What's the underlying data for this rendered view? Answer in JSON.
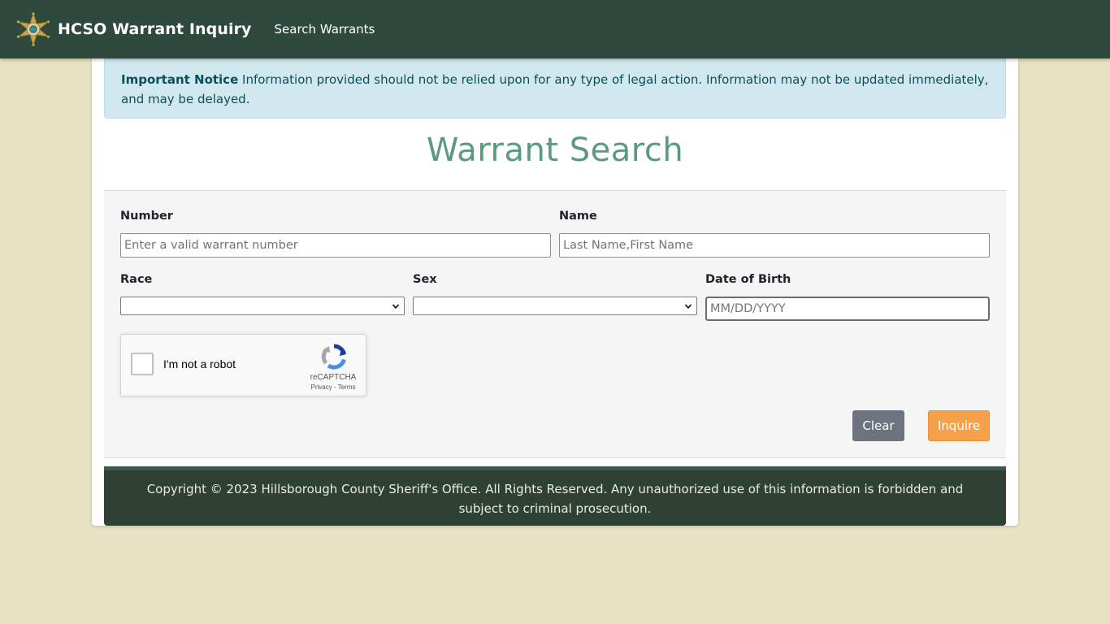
{
  "navbar": {
    "brand": "HCSO Warrant Inquiry",
    "links": [
      "Search Warrants"
    ],
    "logo_icon": "sheriff-star-badge"
  },
  "notice": {
    "heading": "Important Notice",
    "text": "Information provided should not be relied upon for any type of legal action. Information may not be updated immediately, and may be delayed."
  },
  "page_title": "Warrant Search",
  "form": {
    "number_label": "Number",
    "number_placeholder": "Enter a valid warrant number",
    "number_value": "",
    "name_label": "Name",
    "name_placeholder": "Last Name,First Name",
    "name_value": "",
    "race_label": "Race",
    "race_selected": "",
    "sex_label": "Sex",
    "sex_selected": "",
    "dob_label": "Date of Birth",
    "dob_placeholder": "MM/DD/YYYY",
    "dob_value": ""
  },
  "recaptcha": {
    "label": "I'm not a robot",
    "brand": "reCAPTCHA",
    "privacy": "Privacy",
    "separator": " - ",
    "terms": "Terms"
  },
  "buttons": {
    "clear": "Clear",
    "inquire": "Inquire"
  },
  "footer": {
    "text": "Copyright © 2023 Hillsborough County Sheriff's Office. All Rights Reserved. Any unauthorized use of this information is forbidden and subject to criminal prosecution."
  },
  "colors": {
    "navbar_bg": "#2f4a3c",
    "page_bg": "#e8e3c5",
    "notice_bg": "#d1e8ee",
    "title_color": "#5b9a7f",
    "inquire_bg": "#f5a04b",
    "clear_bg": "#6c757d",
    "footer_bg": "#2f4034"
  }
}
